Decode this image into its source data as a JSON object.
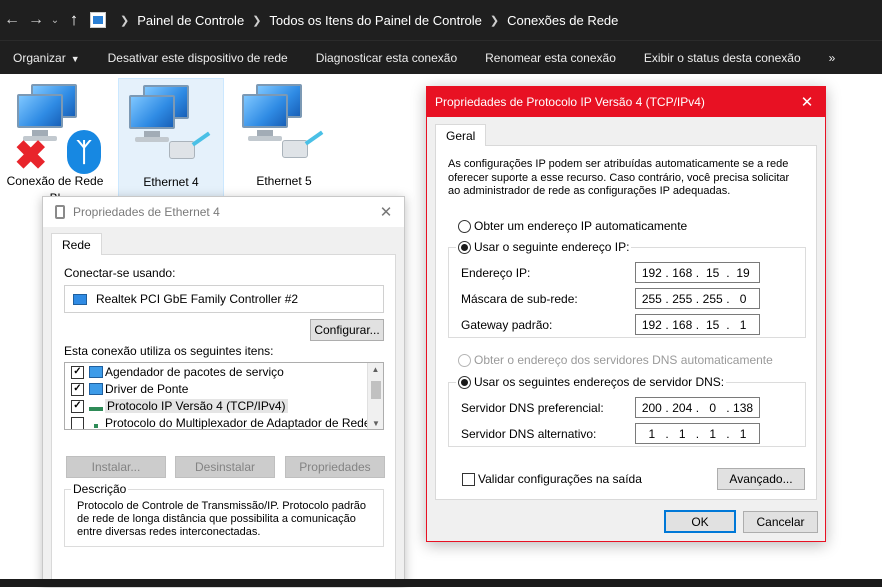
{
  "address_bar": {
    "crumbs": [
      "Painel de Controle",
      "Todos os Itens do Painel de Controle",
      "Conexões de Rede"
    ]
  },
  "toolbar": {
    "organize": "Organizar",
    "disable": "Desativar este dispositivo de rede",
    "diagnose": "Diagnosticar esta conexão",
    "rename": "Renomear esta conexão",
    "status": "Exibir o status desta conexão",
    "more": "»"
  },
  "connections": [
    {
      "label_line1": "Conexão de Rede",
      "label_line2": "Bl"
    },
    {
      "label_line1": "Ethernet 4"
    },
    {
      "label_line1": "Ethernet 5"
    }
  ],
  "eth_dialog": {
    "title": "Propriedades de Ethernet 4",
    "tab": "Rede",
    "connect_using_label": "Conectar-se usando:",
    "adapter": "Realtek PCI GbE Family Controller #2",
    "configure_button": "Configurar...",
    "items_label": "Esta conexão utiliza os seguintes itens:",
    "items": [
      {
        "label": "Agendador de pacotes de serviço",
        "checked": true
      },
      {
        "label": "Driver de Ponte",
        "checked": true
      },
      {
        "label": "Protocolo IP Versão 4 (TCP/IPv4)",
        "checked": true
      },
      {
        "label": "Protocolo do Multiplexador de Adaptador de Rede da M",
        "checked": false
      }
    ],
    "install_button": "Instalar...",
    "uninstall_button": "Desinstalar",
    "properties_button": "Propriedades",
    "description_title": "Descrição",
    "description": "Protocolo de Controle de Transmissão/IP. Protocolo padrão de rede de longa distância que possibilita a comunicação entre diversas redes interconectadas."
  },
  "ipv4_dialog": {
    "title": "Propriedades de Protocolo IP Versão 4 (TCP/IPv4)",
    "tab": "Geral",
    "intro": "As configurações IP podem ser atribuídas automaticamente se a rede oferecer suporte a esse recurso. Caso contrário, você precisa solicitar ao administrador de rede as configurações IP adequadas.",
    "radio_auto_ip": "Obter um endereço IP automaticamente",
    "radio_manual_ip": "Usar o seguinte endereço IP:",
    "ip_label": "Endereço IP:",
    "ip": [
      "192",
      "168",
      "15",
      "19"
    ],
    "mask_label": "Máscara de sub-rede:",
    "mask": [
      "255",
      "255",
      "255",
      "0"
    ],
    "gateway_label": "Gateway padrão:",
    "gateway": [
      "192",
      "168",
      "15",
      "1"
    ],
    "radio_auto_dns": "Obter o endereço dos servidores DNS automaticamente",
    "radio_manual_dns": "Usar os seguintes endereços de servidor DNS:",
    "dns1_label": "Servidor DNS preferencial:",
    "dns1": [
      "200",
      "204",
      "0",
      "138"
    ],
    "dns2_label": "Servidor DNS alternativo:",
    "dns2": [
      "1",
      "1",
      "1",
      "1"
    ],
    "validate_label": "Validar configurações na saída",
    "advanced_button": "Avançado...",
    "ok_button": "OK",
    "cancel_button": "Cancelar",
    "accent_color": "#e81123"
  }
}
